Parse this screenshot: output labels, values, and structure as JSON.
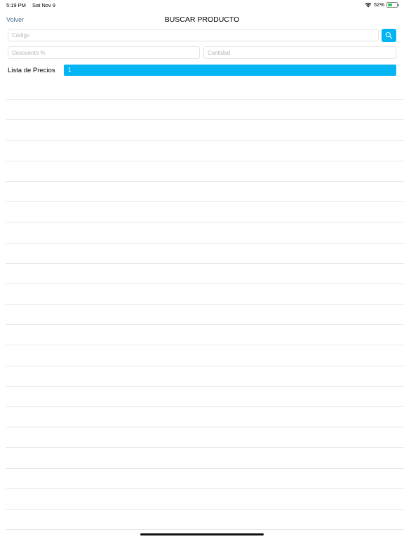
{
  "status_bar": {
    "time": "5:19 PM",
    "date": "Sat Nov 9",
    "battery": "52%",
    "battery_level": 0.52,
    "icons": [
      "wifi-icon",
      "battery-icon"
    ]
  },
  "nav": {
    "back_label": "Volver",
    "title": "BUSCAR PRODUCTO"
  },
  "form": {
    "codigo_placeholder": "Código",
    "codigo_value": "",
    "descuento_placeholder": "Descuento %",
    "descuento_value": "",
    "cantidad_placeholder": "Cantidad",
    "cantidad_value": "",
    "search_icon": "search-icon"
  },
  "price_list": {
    "label": "Lista de Precios",
    "selected": "1"
  },
  "results": {
    "rows": [
      "",
      "",
      "",
      "",
      "",
      "",
      "",
      "",
      "",
      "",
      "",
      "",
      "",
      "",
      "",
      "",
      "",
      "",
      "",
      "",
      "",
      ""
    ]
  },
  "colors": {
    "accent": "#03b5f3",
    "link": "#4a6d8c",
    "border": "#e4e4e4"
  }
}
